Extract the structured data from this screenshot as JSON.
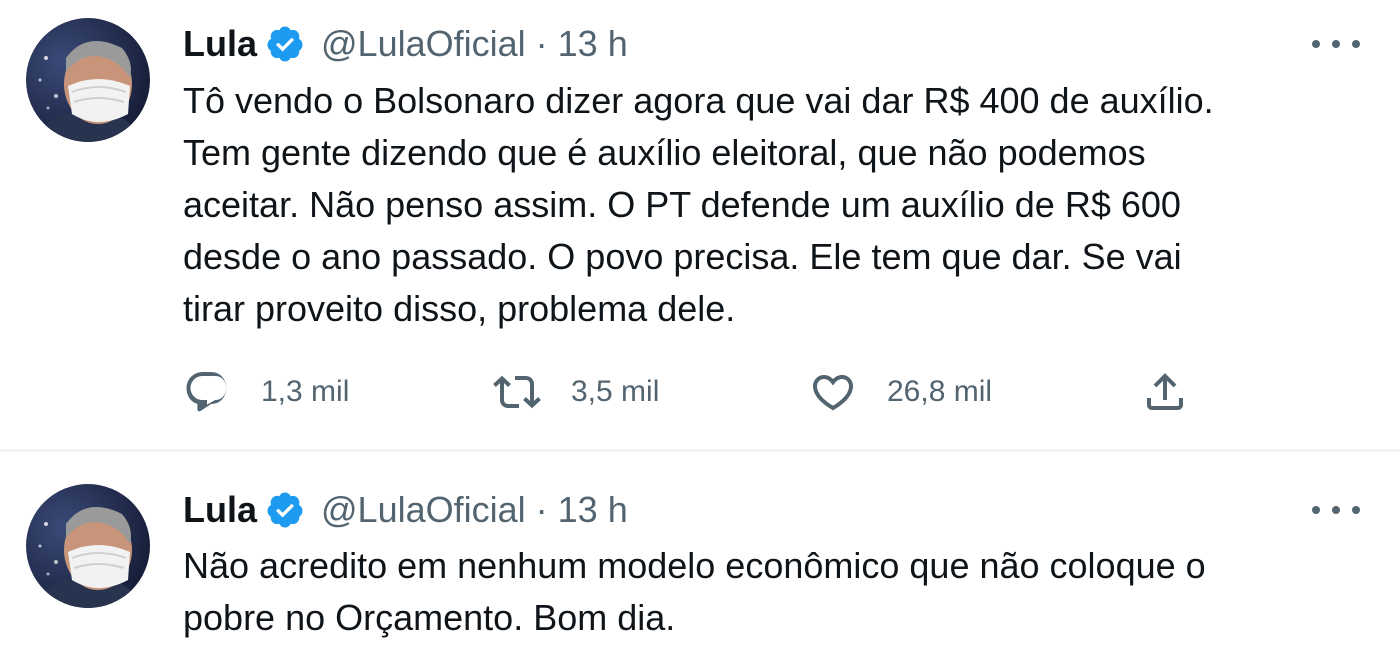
{
  "tweets": [
    {
      "author_name": "Lula",
      "handle": "@LulaOficial",
      "separator": "·",
      "time": "13 h",
      "text_lines": [
        "Tô vendo o Bolsonaro dizer agora que vai dar R$ 400 de auxílio.",
        "Tem gente dizendo que é auxílio eleitoral, que não podemos",
        "aceitar. Não penso assim. O PT defende um auxílio de R$ 600",
        "desde o ano passado. O povo precisa. Ele tem que dar. Se vai",
        "tirar proveito disso, problema dele."
      ],
      "replies": "1,3 mil",
      "retweets": "3,5 mil",
      "likes": "26,8 mil"
    },
    {
      "author_name": "Lula",
      "handle": "@LulaOficial",
      "separator": "·",
      "time": "13 h",
      "text_lines": [
        "Não acredito em nenhum modelo econômico que não coloque o",
        "pobre no Orçamento. Bom dia."
      ]
    }
  ],
  "icons": {
    "verified": "verified-badge-icon",
    "more": "more-horizontal-icon",
    "reply": "reply-icon",
    "retweet": "retweet-icon",
    "like": "heart-icon",
    "share": "share-icon"
  },
  "colors": {
    "verified_blue": "#1d9bf0",
    "secondary_text": "#536471",
    "primary_text": "#0f1419",
    "divider": "#eff3f4"
  }
}
